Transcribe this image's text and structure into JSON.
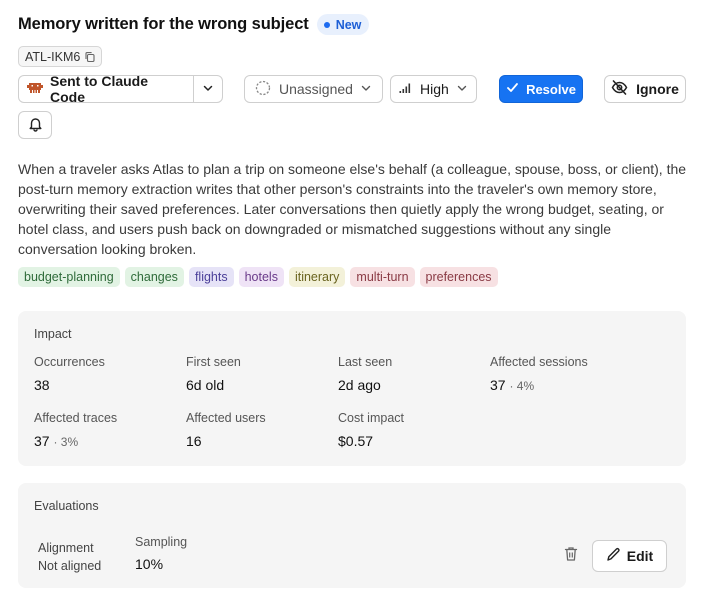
{
  "issue": {
    "title": "Memory written for the wrong subject",
    "status_badge": "New",
    "id": "ATL-IKM6"
  },
  "actions": {
    "integration_label": "Sent to Claude Code",
    "assignee_label": "Unassigned",
    "priority_label": "High",
    "resolve_label": "Resolve",
    "ignore_label": "Ignore"
  },
  "description": "When a traveler asks Atlas to plan a trip on someone else's behalf (a colleague, spouse, boss, or client), the post-turn memory extraction writes that other person's constraints into the traveler's own memory store, overwriting their saved preferences. Later conversations then quietly apply the wrong budget, seating, or hotel class, and users push back on downgraded or mismatched suggestions without any single conversation looking broken.",
  "tags": [
    {
      "label": "budget-planning",
      "bg": "#e2f3e4",
      "fg": "#2f6b3a"
    },
    {
      "label": "changes",
      "bg": "#e2f3e4",
      "fg": "#2f6b3a"
    },
    {
      "label": "flights",
      "bg": "#e6e3f7",
      "fg": "#4b3f99"
    },
    {
      "label": "hotels",
      "bg": "#efe3f6",
      "fg": "#6a3a8a"
    },
    {
      "label": "itinerary",
      "bg": "#f3f1d9",
      "fg": "#6a6420"
    },
    {
      "label": "multi-turn",
      "bg": "#f7e1e3",
      "fg": "#8a3a44"
    },
    {
      "label": "preferences",
      "bg": "#f7e1e3",
      "fg": "#8a3a44"
    }
  ],
  "impact": {
    "title": "Impact",
    "stats": [
      {
        "label": "Occurrences",
        "value": "38",
        "sub": ""
      },
      {
        "label": "First seen",
        "value": "6d old",
        "sub": ""
      },
      {
        "label": "Last seen",
        "value": "2d ago",
        "sub": ""
      },
      {
        "label": "Affected sessions",
        "value": "37",
        "sub": "· 4%"
      },
      {
        "label": "Affected traces",
        "value": "37",
        "sub": "· 3%"
      },
      {
        "label": "Affected users",
        "value": "16",
        "sub": ""
      },
      {
        "label": "Cost impact",
        "value": "$0.57",
        "sub": ""
      }
    ]
  },
  "evaluations": {
    "title": "Evaluations",
    "name": "Alignment",
    "status": "Not aligned",
    "sampling_label": "Sampling",
    "sampling_value": "10%",
    "edit_label": "Edit"
  },
  "colors": {
    "accent": "#1673f2",
    "integration_icon": "#c0552a"
  }
}
